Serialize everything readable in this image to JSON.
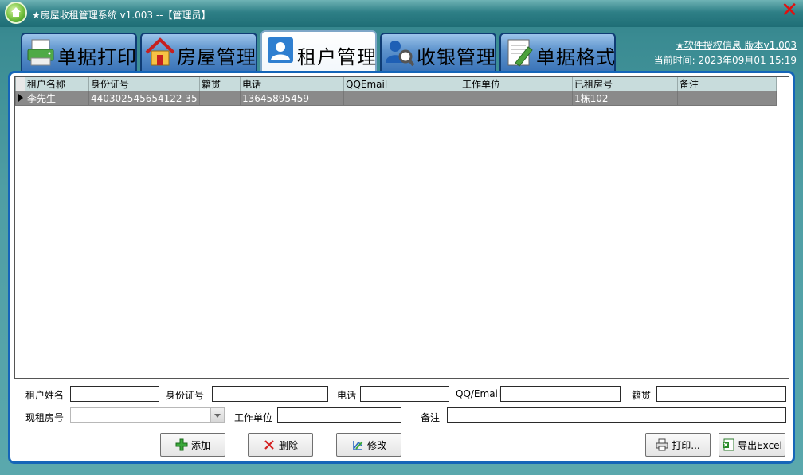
{
  "window": {
    "title": "★房屋收租管理系统 v1.003  --【管理员】",
    "close_glyph": "✕"
  },
  "tabs": [
    {
      "label": "单据打印",
      "icon": "printer-icon",
      "active": false
    },
    {
      "label": "房屋管理",
      "icon": "house-icon",
      "active": false
    },
    {
      "label": "租户管理",
      "icon": "user-icon",
      "active": true
    },
    {
      "label": "收银管理",
      "icon": "search-user-icon",
      "active": false
    },
    {
      "label": "单据格式",
      "icon": "edit-document-icon",
      "active": false
    }
  ],
  "info": {
    "license_link": "★软件授权信息 版本v1.003",
    "current_time": "当前时间: 2023年09月01 15:19"
  },
  "table": {
    "columns": [
      "租户名称",
      "身份证号",
      "籍贯",
      "电话",
      "QQEmail",
      "工作单位",
      "已租房号",
      "备注"
    ],
    "rows": [
      [
        "李先生",
        "440302545654122 35",
        "",
        "13645895459",
        "",
        "",
        "1栋102",
        ""
      ]
    ]
  },
  "form": {
    "name_label": "租户姓名",
    "id_label": "身份证号",
    "phone_label": "电话",
    "qq_label": "QQ/Email",
    "origin_label": "籍贯",
    "room_label": "现租房号",
    "work_label": "工作单位",
    "note_label": "备注"
  },
  "buttons": {
    "add": "添加",
    "delete": "删除",
    "edit": "修改",
    "print": "打印...",
    "export": "导出Excel"
  },
  "colors": {
    "panel_border": "#1565b8",
    "selected_row": "#8a8a8a",
    "header_bg": "#c8dcdc"
  }
}
